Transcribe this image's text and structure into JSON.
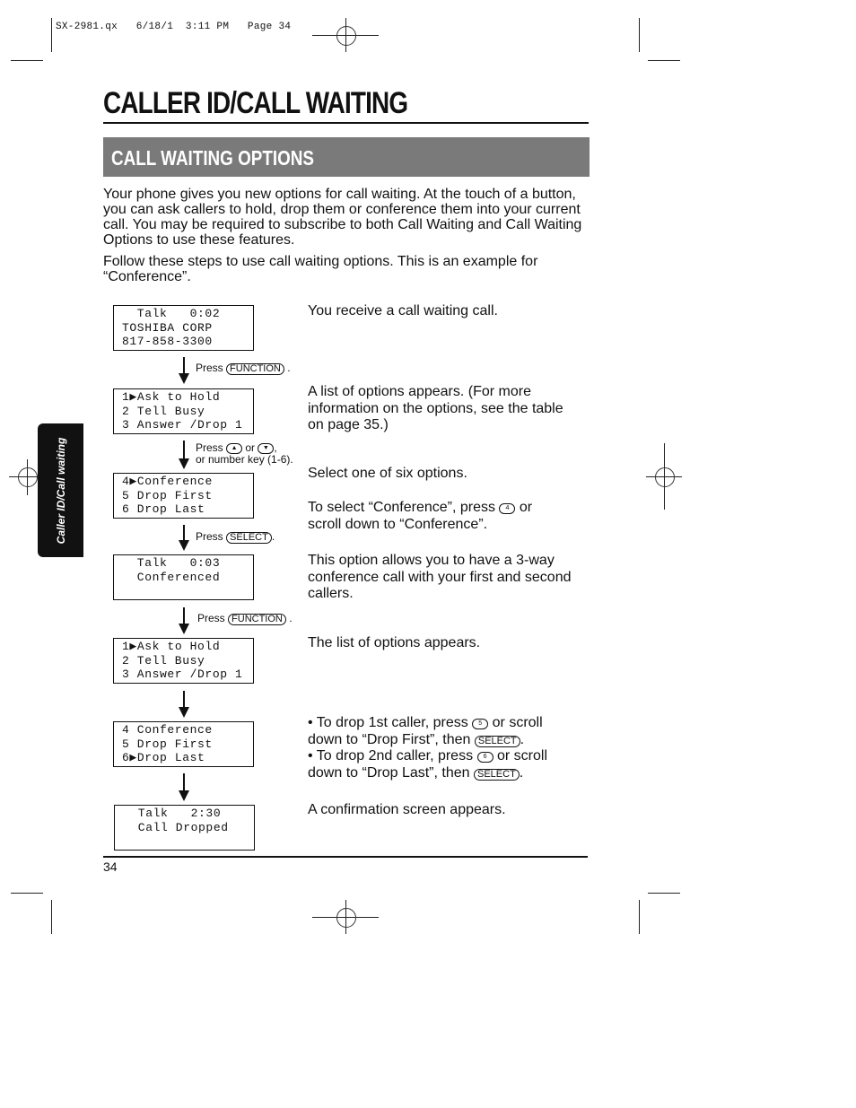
{
  "slug": "SX-2981.qx   6/18/1  3:11 PM   Page 34",
  "title": "CALLER ID/CALL WAITING",
  "section": "CALL WAITING OPTIONS",
  "side_tab": "Caller ID/Call waiting",
  "intro": [
    "Your phone gives you new options for call waiting. At the touch of a button, you can ask callers to hold, drop them or conference them into your current call. You may be required to subscribe to both Call Waiting and Call Waiting Options to use these features.",
    "Follow these steps to use call waiting options. This is an example for “Conference”."
  ],
  "lcd": [
    "  Talk   0:02\nTOSHIBA CORP\n817-858-3300",
    "1▶Ask to Hold\n2 Tell Busy\n3 Answer /Drop 1",
    "4▶Conference\n5 Drop First\n6 Drop Last",
    "  Talk   0:03\n  Conferenced",
    "1▶Ask to Hold\n2 Tell Busy\n3 Answer /Drop 1",
    "4 Conference\n5 Drop First\n6▶Drop Last",
    "  Talk   2:30\n  Call Dropped"
  ],
  "arrows": {
    "press": "Press",
    "or": "or",
    "number_key": "or number key (1-6).",
    "function_key": "FUNCTION",
    "select_key": "SELECT",
    "up_key": "▲",
    "down_key": "▼",
    "period": ".",
    "comma": ","
  },
  "desc": {
    "d1": "You receive a call waiting call.",
    "d2": "A list of options appears. (For more information on the options, see the table on page 35.)",
    "d3": "Select one of six options.",
    "d3b_pre": "To select “Conference”, press",
    "d3b_key": "4",
    "d3b_post": "or scroll down to “Conference”.",
    "d4": "This option allows you to have a 3-way conference call with your first and second callers.",
    "d5": "The list of options appears.",
    "b1_pre": "• To drop 1st caller, press",
    "b1_key": "5",
    "b1_mid": "or scroll down to “Drop First”, then",
    "b1_end": ".",
    "b2_pre": "• To drop 2nd caller, press",
    "b2_key": "6",
    "b2_mid": "or scroll down to “Drop Last”, then",
    "b2_end": ".",
    "d7": "A confirmation screen appears."
  },
  "page_number": "34"
}
